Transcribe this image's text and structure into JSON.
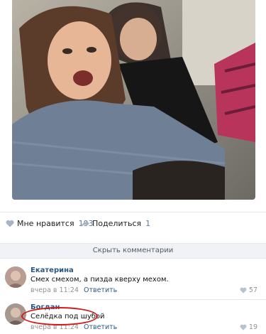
{
  "post": {
    "photo_alt": "selfie"
  },
  "actions": {
    "like_label": "Мне нравится",
    "like_count": "193",
    "share_label": "Поделиться",
    "share_count": "1"
  },
  "comments_bar": {
    "hide_label": "Скрыть комментарии"
  },
  "comments": [
    {
      "author": "Екатерина",
      "text": "Смех смехом, а пизда кверху мехом.",
      "time": "вчера в 11:24",
      "reply_label": "Ответить",
      "likes": "57"
    },
    {
      "author": "Богдан",
      "text": "Селёдка под шубой",
      "time": "вчера в 11:24",
      "reply_label": "Ответить",
      "likes": "19"
    }
  ],
  "colors": {
    "link": "#2a5885",
    "meta": "#939393",
    "highlight": "#d21a1a"
  }
}
